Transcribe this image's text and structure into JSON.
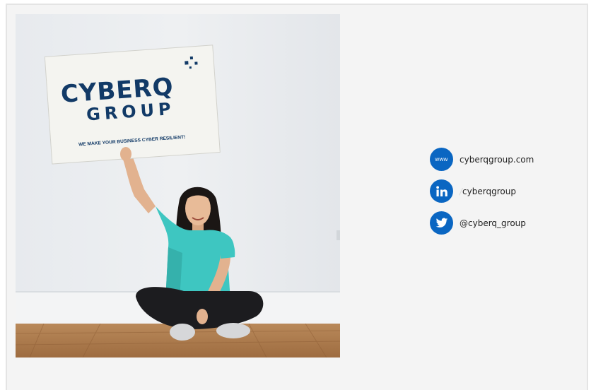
{
  "photo": {
    "sign": {
      "brand_top": "CYBERQ",
      "brand_bottom": "GROUP",
      "tagline": "WE MAKE YOUR BUSINESS CYBER RESILIENT!"
    }
  },
  "contacts": {
    "website": {
      "icon_text": "www",
      "label": "cyberqgroup.com"
    },
    "linkedin": {
      "prefix": "/",
      "label": "cyberqgroup"
    },
    "twitter": {
      "label": "@cyberq_group"
    }
  },
  "colors": {
    "brand_blue": "#0a66c2",
    "logo_navy": "#123a67"
  }
}
